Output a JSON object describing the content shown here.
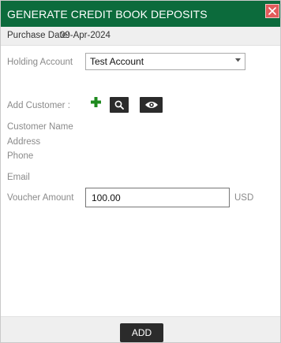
{
  "dialog": {
    "title": "GENERATE CREDIT BOOK DEPOSITS",
    "close_icon": "close-icon"
  },
  "purchase": {
    "label": "Purchase Date:",
    "date": "09-Apr-2024"
  },
  "form": {
    "holding_account_label": "Holding Account",
    "holding_account_value": "Test Account",
    "add_customer_label": "Add Customer :",
    "customer_name_label": "Customer Name",
    "address_label": "Address",
    "phone_label": "Phone",
    "email_label": "Email",
    "voucher_amount_label": "Voucher Amount",
    "voucher_amount_value": "100.00",
    "currency": "USD"
  },
  "icons": {
    "add": "plus-icon",
    "search": "search-icon",
    "view": "eye-icon",
    "dropdown": "chevron-down-icon"
  },
  "colors": {
    "title_bar": "#0c6b3c",
    "close_button": "#e35b5b",
    "add_icon": "#1e8a1e",
    "dark_button": "#2b2b2b"
  },
  "footer": {
    "add_label": "ADD"
  }
}
